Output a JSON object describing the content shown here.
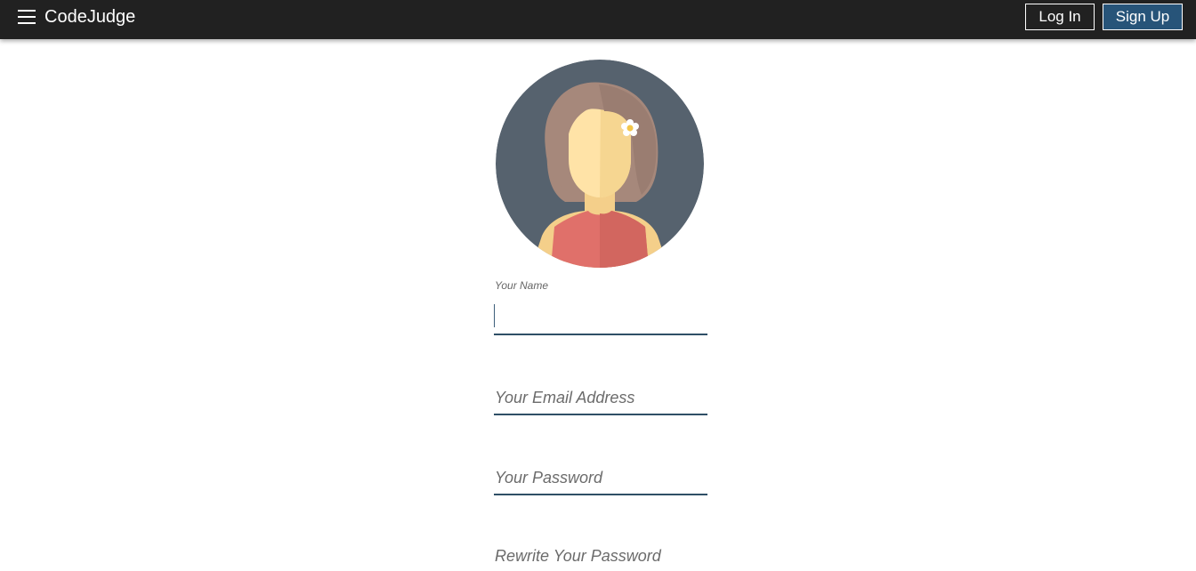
{
  "navbar": {
    "brand": "CodeJudge",
    "menu_icon": "hamburger-menu-icon",
    "login_label": "Log In",
    "signup_label": "Sign Up"
  },
  "avatar": {
    "icon": "female-avatar-icon"
  },
  "form": {
    "name_label": "Your Name",
    "name_value": "",
    "email_placeholder": "Your Email Address",
    "password_placeholder": "Your Password",
    "confirm_password_placeholder": "Rewrite Your Password"
  },
  "colors": {
    "navbar_bg": "#212121",
    "signup_bg": "#275479",
    "field_underline": "#2f4f66",
    "avatar_bg": "#56626e"
  }
}
